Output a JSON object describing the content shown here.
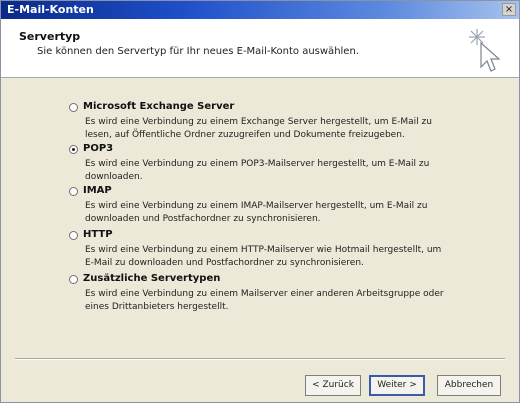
{
  "window": {
    "title": "E-Mail-Konten",
    "close_label": "×"
  },
  "header": {
    "title": "Servertyp",
    "subtitle": "Sie können den Servertyp für Ihr neues E-Mail-Konto auswählen."
  },
  "options": [
    {
      "label": "Microsoft Exchange Server",
      "description": "Es wird eine Verbindung zu einem Exchange Server hergestellt, um E-Mail zu lesen, auf Öffentliche Ordner zuzugreifen und Dokumente freizugeben.",
      "selected": false
    },
    {
      "label": "POP3",
      "description": "Es wird eine Verbindung zu einem POP3-Mailserver hergestellt, um E-Mail zu downloaden.",
      "selected": true
    },
    {
      "label": "IMAP",
      "description": "Es wird eine Verbindung zu einem IMAP-Mailserver hergestellt, um E-Mail zu downloaden und Postfachordner zu synchronisieren.",
      "selected": false
    },
    {
      "label": "HTTP",
      "description": "Es wird eine Verbindung zu einem HTTP-Mailserver wie Hotmail hergestellt, um E-Mail zu downloaden und Postfachordner zu synchronisieren.",
      "selected": false
    },
    {
      "label": "Zusätzliche Servertypen",
      "description": "Es wird eine Verbindung zu einem Mailserver einer anderen Arbeitsgruppe oder eines Drittanbieters hergestellt.",
      "selected": false
    }
  ],
  "footer": {
    "back_label": "< Zurück",
    "next_label": "Weiter >",
    "cancel_label": "Abbrechen"
  },
  "colors": {
    "titlebar_start": "#0a2a8a",
    "titlebar_end": "#a8c2ee",
    "dialog_bg": "#ece9d8",
    "header_bg": "#ffffff"
  },
  "icons": {
    "wizard": "wizard-sparkle-cursor-icon"
  }
}
